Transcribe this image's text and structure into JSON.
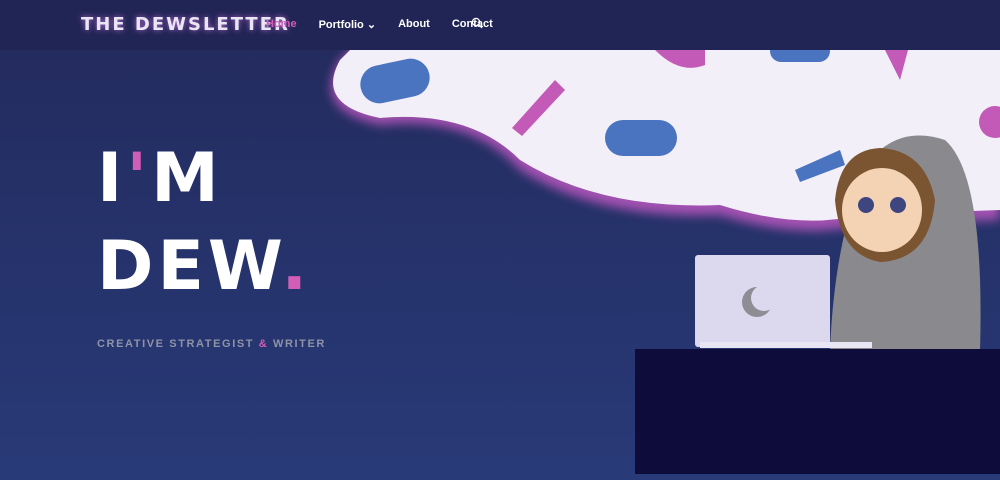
{
  "nav": {
    "logo": "THE DEWSLETTER",
    "items": [
      {
        "label": "Home"
      },
      {
        "label": "Portfolio"
      },
      {
        "label": "About"
      },
      {
        "label": "Contact"
      }
    ],
    "accent": "#d25db7"
  },
  "hero": {
    "line1_a": "I",
    "line1_apos": "'",
    "line1_b": "M",
    "line2": "DEW",
    "dot": ".",
    "subtitle_a": "CREATIVE STRATEGIST",
    "subtitle_amp": "&",
    "subtitle_b": "WRITER"
  }
}
